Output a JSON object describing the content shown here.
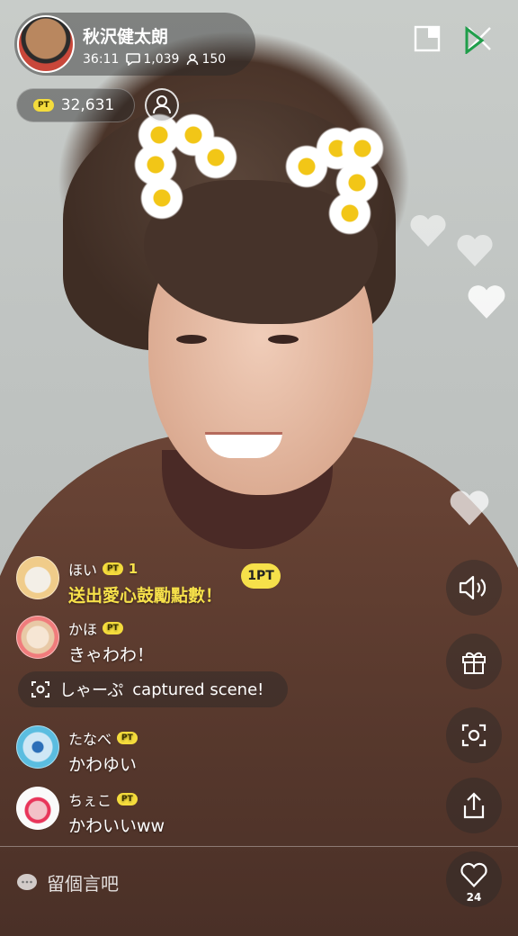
{
  "host": {
    "name": "秋沢健太朗",
    "duration": "36:11",
    "comment_count": "1,039",
    "viewer_count": "150"
  },
  "points": {
    "badge": "PT",
    "value": "32,631"
  },
  "comments": [
    {
      "user": "ほい",
      "badge": "PT",
      "pt": "1",
      "text": "送出愛心鼓勵點數！",
      "highlight": true
    },
    {
      "user": "かほ",
      "badge": "PT",
      "text": "きゃわわ！"
    },
    {
      "user": "たなべ",
      "badge": "PT",
      "text": "かわゆい"
    },
    {
      "user": "ちぇこ",
      "badge": "PT",
      "text": "かわいいww"
    }
  ],
  "gift_badge": "1PT",
  "capture": {
    "user": "しゃーぷ",
    "message": "captured scene!"
  },
  "input": {
    "placeholder": "留個言吧"
  },
  "likes": "24",
  "colors": {
    "accent_yellow": "#f6e04a",
    "overlay_dark": "rgba(40,40,40,0.45)"
  },
  "icons": [
    "pip-icon",
    "close-icon",
    "profile-icon",
    "volume-icon",
    "gift-icon",
    "camera-icon",
    "share-icon",
    "heart-icon",
    "chat-bubble-icon"
  ]
}
